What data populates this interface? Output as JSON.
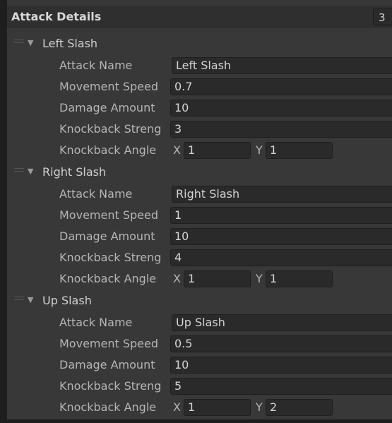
{
  "header": {
    "title": "Attack Details",
    "count": "3"
  },
  "attacks": [
    {
      "title": "Left Slash",
      "attack_name_label": "Attack Name",
      "attack_name": "Left Slash",
      "movement_speed_label": "Movement Speed",
      "movement_speed": "0.7",
      "damage_amount_label": "Damage Amount",
      "damage_amount": "10",
      "knockback_strength_label": "Knockback Streng",
      "knockback_strength": "3",
      "knockback_angle_label": "Knockback Angle",
      "x_label": "X",
      "x": "1",
      "y_label": "Y",
      "y": "1"
    },
    {
      "title": "Right Slash",
      "attack_name_label": "Attack Name",
      "attack_name": "Right Slash",
      "movement_speed_label": "Movement Speed",
      "movement_speed": "1",
      "damage_amount_label": "Damage Amount",
      "damage_amount": "10",
      "knockback_strength_label": "Knockback Streng",
      "knockback_strength": "4",
      "knockback_angle_label": "Knockback Angle",
      "x_label": "X",
      "x": "1",
      "y_label": "Y",
      "y": "1"
    },
    {
      "title": "Up Slash",
      "attack_name_label": "Attack Name",
      "attack_name": "Up Slash",
      "movement_speed_label": "Movement Speed",
      "movement_speed": "0.5",
      "damage_amount_label": "Damage Amount",
      "damage_amount": "10",
      "knockback_strength_label": "Knockback Streng",
      "knockback_strength": "5",
      "knockback_angle_label": "Knockback Angle",
      "x_label": "X",
      "x": "1",
      "y_label": "Y",
      "y": "2"
    }
  ]
}
